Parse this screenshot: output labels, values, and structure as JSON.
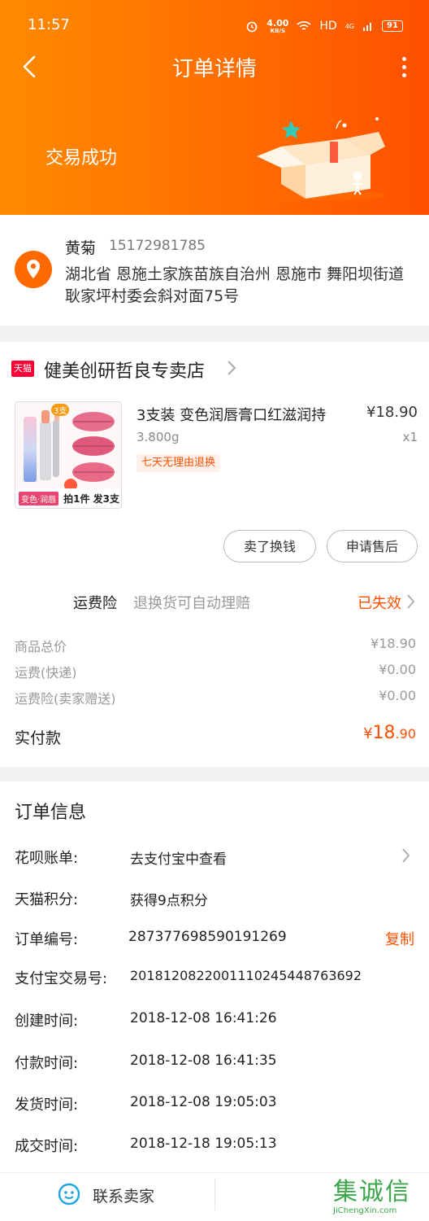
{
  "status_bar": {
    "time": "11:57",
    "net_speed_value": "4.00",
    "net_speed_unit": "KB/S",
    "hd": "HD",
    "signal": "4G",
    "battery": "91"
  },
  "header": {
    "title": "订单详情",
    "order_status": "交易成功"
  },
  "address": {
    "name": "黄菊",
    "phone": "15172981785",
    "detail": "湖北省 恩施土家族苗族自治州 恩施市 舞阳坝街道 耿家坪村委会斜对面75号"
  },
  "store": {
    "badge": "天猫",
    "name": "健美创研哲良专卖店"
  },
  "product": {
    "title": "3支装 变色润唇膏口红滋润持",
    "sku": "3.800g",
    "tag": "七天无理由退换",
    "price": "¥18.90",
    "qty": "x1",
    "image_badge": "3支",
    "image_caption_left": "变色·润唇",
    "image_caption_right": "拍1件 发3支"
  },
  "actions": {
    "sell_label": "卖了换钱",
    "after_sale_label": "申请售后"
  },
  "insurance": {
    "label": "运费险",
    "desc": "退换货可自动理赔",
    "status": "已失效"
  },
  "fees": [
    {
      "label": "商品总价",
      "value": "¥18.90"
    },
    {
      "label": "运费(快递)",
      "value": "¥0.00"
    },
    {
      "label": "运费险(卖家赠送)",
      "value": "¥0.00"
    }
  ],
  "total": {
    "label": "实付款",
    "currency": "¥",
    "integer": "18",
    "decimal": ".90"
  },
  "order_info": {
    "title": "订单信息",
    "rows": [
      {
        "label": "花呗账单:",
        "value": "去支付宝中查看"
      },
      {
        "label": "天猫积分:",
        "value": "获得9点积分"
      },
      {
        "label": "订单编号:",
        "value": "287377698590191269"
      },
      {
        "label": "支付宝交易号:",
        "value": "2018120822001110245448763692"
      },
      {
        "label": "创建时间:",
        "value": "2018-12-08 16:41:26"
      },
      {
        "label": "付款时间:",
        "value": "2018-12-08 16:41:35"
      },
      {
        "label": "发货时间:",
        "value": "2018-12-08 19:05:03"
      },
      {
        "label": "成交时间:",
        "value": "2018-12-18 19:05:13"
      }
    ],
    "copy_label": "复制"
  },
  "bottom_bar": {
    "contact_label": "联系卖家"
  },
  "watermark": {
    "text": "集诚信",
    "subtext": "JiChengXin.com"
  },
  "colors": {
    "accent": "#ff5000",
    "header_start": "#ff8a00",
    "header_end": "#ff5000",
    "tmall_red": "#ff0036"
  }
}
